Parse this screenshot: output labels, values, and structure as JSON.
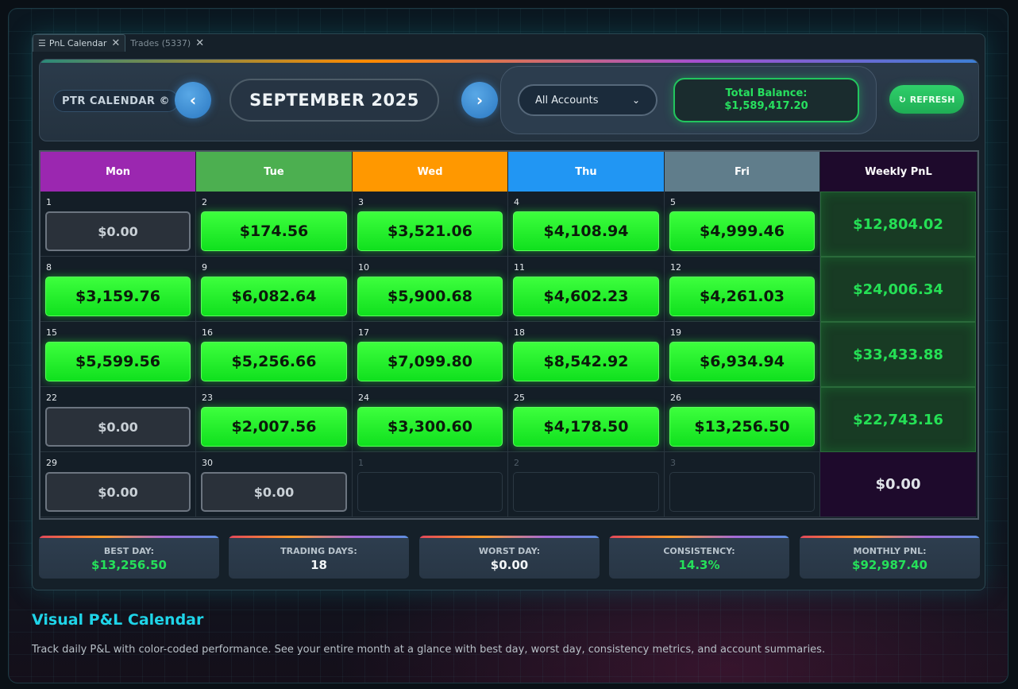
{
  "tabs": [
    {
      "label": "PnL Calendar",
      "active": true
    },
    {
      "label": "Trades (5337)",
      "active": false
    }
  ],
  "header": {
    "brand": "PTR CALENDAR ©",
    "prev_icon": "‹",
    "next_icon": "›",
    "month": "SEPTEMBER 2025",
    "account_select": "All Accounts",
    "balance_label": "Total Balance:",
    "balance_value": "$1,589,417.20",
    "refresh_label": "REFRESH"
  },
  "calendar": {
    "headers": [
      "Mon",
      "Tue",
      "Wed",
      "Thu",
      "Fri",
      "Weekly PnL"
    ],
    "header_colors": [
      "#9b27b0",
      "#4caf50",
      "#ff9800",
      "#2196f3",
      "#607d8b",
      "#1e0a2c"
    ],
    "weeks": [
      {
        "days": [
          {
            "day": "1",
            "value": "$0.00",
            "kind": "zero"
          },
          {
            "day": "2",
            "value": "$174.56",
            "kind": "pos"
          },
          {
            "day": "3",
            "value": "$3,521.06",
            "kind": "pos"
          },
          {
            "day": "4",
            "value": "$4,108.94",
            "kind": "pos"
          },
          {
            "day": "5",
            "value": "$4,999.46",
            "kind": "pos"
          }
        ],
        "weekly": "$12,804.02",
        "weekly_kind": "green"
      },
      {
        "days": [
          {
            "day": "8",
            "value": "$3,159.76",
            "kind": "pos"
          },
          {
            "day": "9",
            "value": "$6,082.64",
            "kind": "pos"
          },
          {
            "day": "10",
            "value": "$5,900.68",
            "kind": "pos"
          },
          {
            "day": "11",
            "value": "$4,602.23",
            "kind": "pos"
          },
          {
            "day": "12",
            "value": "$4,261.03",
            "kind": "pos"
          }
        ],
        "weekly": "$24,006.34",
        "weekly_kind": "green"
      },
      {
        "days": [
          {
            "day": "15",
            "value": "$5,599.56",
            "kind": "pos"
          },
          {
            "day": "16",
            "value": "$5,256.66",
            "kind": "pos"
          },
          {
            "day": "17",
            "value": "$7,099.80",
            "kind": "pos"
          },
          {
            "day": "18",
            "value": "$8,542.92",
            "kind": "pos"
          },
          {
            "day": "19",
            "value": "$6,934.94",
            "kind": "pos"
          }
        ],
        "weekly": "$33,433.88",
        "weekly_kind": "green"
      },
      {
        "days": [
          {
            "day": "22",
            "value": "$0.00",
            "kind": "zero"
          },
          {
            "day": "23",
            "value": "$2,007.56",
            "kind": "pos"
          },
          {
            "day": "24",
            "value": "$3,300.60",
            "kind": "pos"
          },
          {
            "day": "25",
            "value": "$4,178.50",
            "kind": "pos"
          },
          {
            "day": "26",
            "value": "$13,256.50",
            "kind": "pos"
          }
        ],
        "weekly": "$22,743.16",
        "weekly_kind": "green"
      },
      {
        "days": [
          {
            "day": "29",
            "value": "$0.00",
            "kind": "zero"
          },
          {
            "day": "30",
            "value": "$0.00",
            "kind": "zero"
          },
          {
            "day": "1",
            "value": "",
            "kind": "empty"
          },
          {
            "day": "2",
            "value": "",
            "kind": "empty"
          },
          {
            "day": "3",
            "value": "",
            "kind": "empty"
          }
        ],
        "weekly": "$0.00",
        "weekly_kind": "zero"
      }
    ]
  },
  "stats": [
    {
      "label": "BEST DAY:",
      "value": "$13,256.50",
      "color": "green"
    },
    {
      "label": "TRADING DAYS:",
      "value": "18",
      "color": "white"
    },
    {
      "label": "WORST DAY:",
      "value": "$0.00",
      "color": "white"
    },
    {
      "label": "CONSISTENCY:",
      "value": "14.3%",
      "color": "green"
    },
    {
      "label": "MONTHLY PNL:",
      "value": "$92,987.40",
      "color": "green"
    }
  ],
  "feature": {
    "title": "Visual P&L Calendar",
    "description": "Track daily P&L with color-coded performance. See your entire month at a glance with best day, worst day, consistency metrics, and account summaries."
  }
}
